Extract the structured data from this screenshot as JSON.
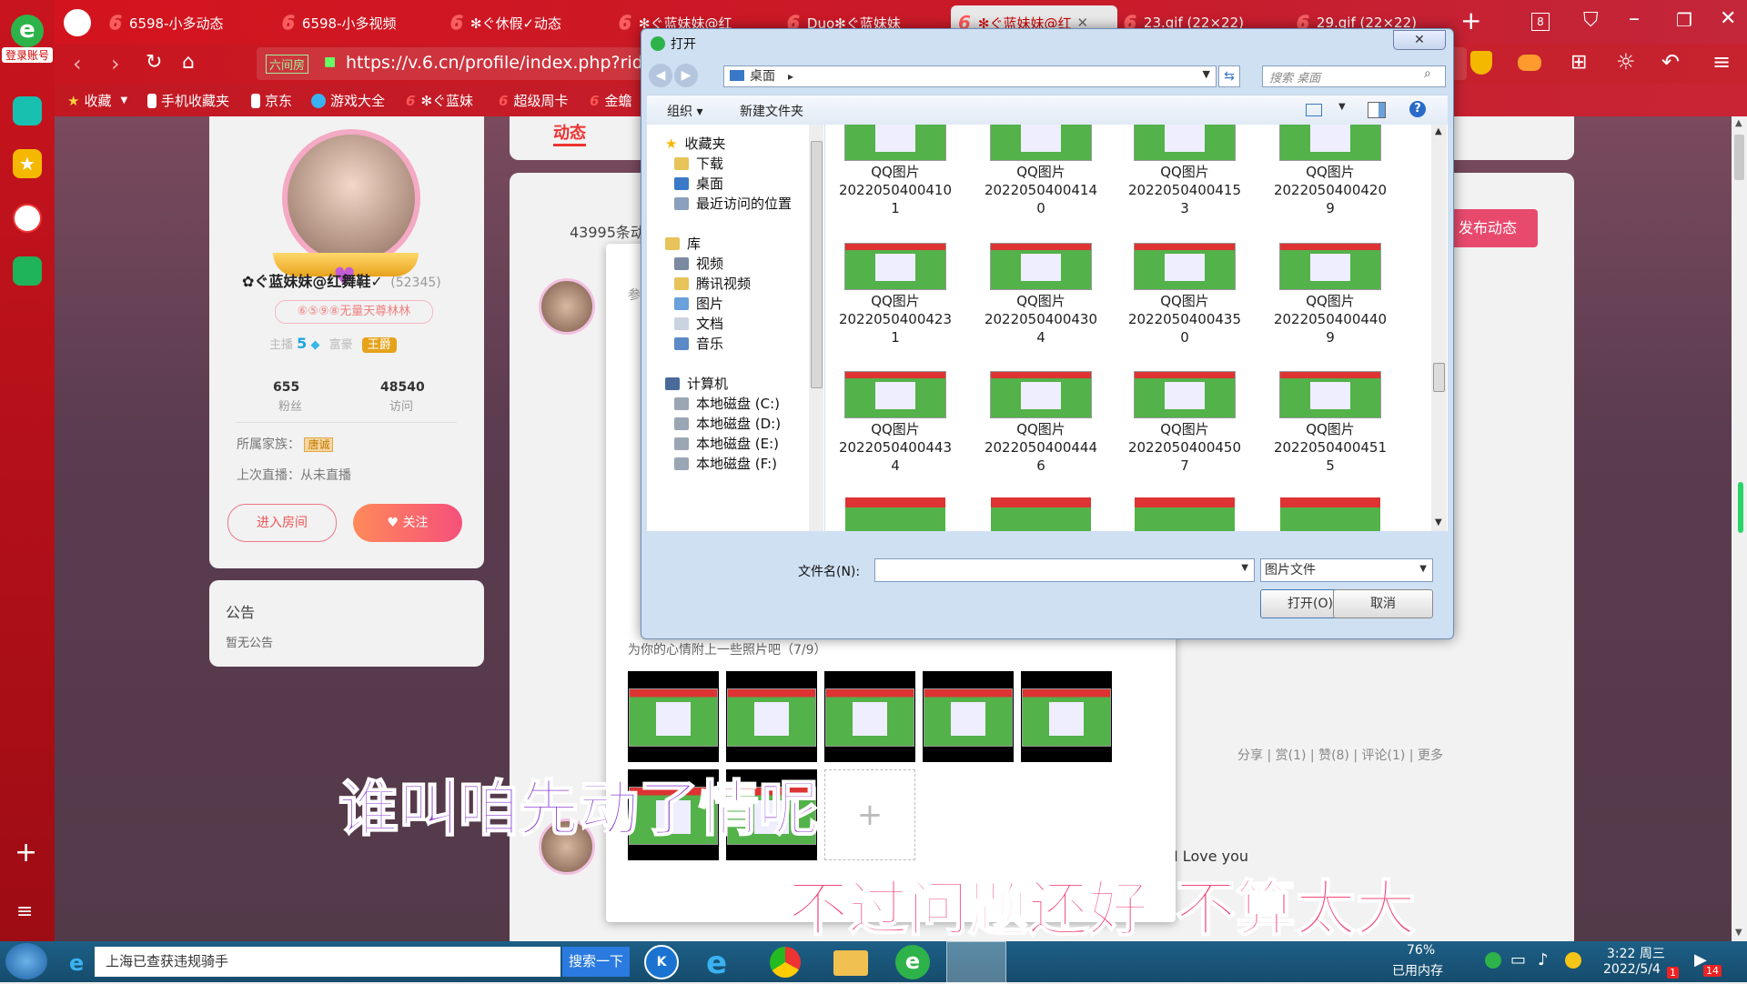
{
  "browser": {
    "tabs": [
      {
        "label": "6598-小多动态"
      },
      {
        "label": "6598-小多视频"
      },
      {
        "label": "✻ぐ休假✓动态"
      },
      {
        "label": "✻ぐ蓝妹妹@红"
      },
      {
        "label": "Duo✻ぐ蓝妹妹"
      },
      {
        "label": "✻ぐ蓝妹妹@红"
      },
      {
        "label": "23.gif (22×22)"
      },
      {
        "label": "29.gif (22×22)"
      }
    ],
    "tab_count": "8",
    "login_label": "登录账号",
    "url_badge": "六间房",
    "url": "https://v.6.cn/profile/index.php?rid-",
    "bookmarks": [
      {
        "label": "收藏"
      },
      {
        "label": "手机收藏夹"
      },
      {
        "label": "京东"
      },
      {
        "label": "游戏大全"
      },
      {
        "label": "✻ぐ蓝妹"
      },
      {
        "label": "超级周卡"
      },
      {
        "label": "金蟾"
      }
    ]
  },
  "profile": {
    "name": "✿ぐ蓝妹妹@红舞鞋✓",
    "id": "(52345)",
    "family_tag": "⑥⑤⑨⑧无量天尊林林",
    "anchor_label": "主播",
    "anchor_level": "5",
    "rich_label": "富豪",
    "rank_badge": "王爵",
    "fans_count": "655",
    "fans_label": "粉丝",
    "visits_count": "48540",
    "visits_label": "访问",
    "family_label": "所属家族：",
    "family_value": "唐诚",
    "last_live": "上次直播：从未直播",
    "enter_room": "进入房间",
    "follow": "关注",
    "notice_title": "公告",
    "notice_body": "暂无公告"
  },
  "feed": {
    "tab_active": "动态",
    "count_text": "43995条动",
    "publish_button": "发布动态",
    "actions": "分享 | 赏(1) | 赞(8) | 评论(1) | 更多",
    "love_text": "I Love you",
    "char_left": "参"
  },
  "post_modal": {
    "photo_hint": "为你的心情附上一些照片吧（7/9）",
    "add_symbol": "+"
  },
  "dialog": {
    "title": "打开",
    "location": "桌面",
    "search_placeholder": "搜索 桌面",
    "organize": "组织 ▾",
    "new_folder": "新建文件夹",
    "nav": [
      {
        "label": "收藏夹"
      },
      {
        "label": "下载"
      },
      {
        "label": "桌面"
      },
      {
        "label": "最近访问的位置"
      },
      {
        "label": "库"
      },
      {
        "label": "视频"
      },
      {
        "label": "腾讯视频"
      },
      {
        "label": "图片"
      },
      {
        "label": "文档"
      },
      {
        "label": "音乐"
      },
      {
        "label": "计算机"
      },
      {
        "label": "本地磁盘 (C:)"
      },
      {
        "label": "本地磁盘 (D:)"
      },
      {
        "label": "本地磁盘 (E:)"
      },
      {
        "label": "本地磁盘 (F:)"
      }
    ],
    "files": [
      {
        "line1": "QQ图片",
        "line2": "2022050400410",
        "line3": "1"
      },
      {
        "line1": "QQ图片",
        "line2": "2022050400414",
        "line3": "0"
      },
      {
        "line1": "QQ图片",
        "line2": "2022050400415",
        "line3": "3"
      },
      {
        "line1": "QQ图片",
        "line2": "2022050400420",
        "line3": "9"
      },
      {
        "line1": "QQ图片",
        "line2": "2022050400423",
        "line3": "1"
      },
      {
        "line1": "QQ图片",
        "line2": "2022050400430",
        "line3": "4"
      },
      {
        "line1": "QQ图片",
        "line2": "2022050400435",
        "line3": "0"
      },
      {
        "line1": "QQ图片",
        "line2": "2022050400440",
        "line3": "9"
      },
      {
        "line1": "QQ图片",
        "line2": "2022050400443",
        "line3": "4"
      },
      {
        "line1": "QQ图片",
        "line2": "2022050400444",
        "line3": "6"
      },
      {
        "line1": "QQ图片",
        "line2": "2022050400450",
        "line3": "7"
      },
      {
        "line1": "QQ图片",
        "line2": "2022050400451",
        "line3": "5"
      }
    ],
    "filename_label": "文件名(N):",
    "filename_value": "",
    "filetype": "图片文件",
    "open_button": "打开(O)",
    "cancel_button": "取消"
  },
  "subtitles": {
    "line1": "谁叫咱先动了情呢",
    "line2a": "不过问题还好",
    "line2b": "不算太大"
  },
  "taskbar": {
    "search_text": "上海已查获违规骑手",
    "search_button": "搜索一下",
    "memory_percent": "76%",
    "memory_label": "已用内存",
    "time": "3:22 周三",
    "date": "2022/5/4",
    "date_badge": "1",
    "notif_count": "14"
  }
}
